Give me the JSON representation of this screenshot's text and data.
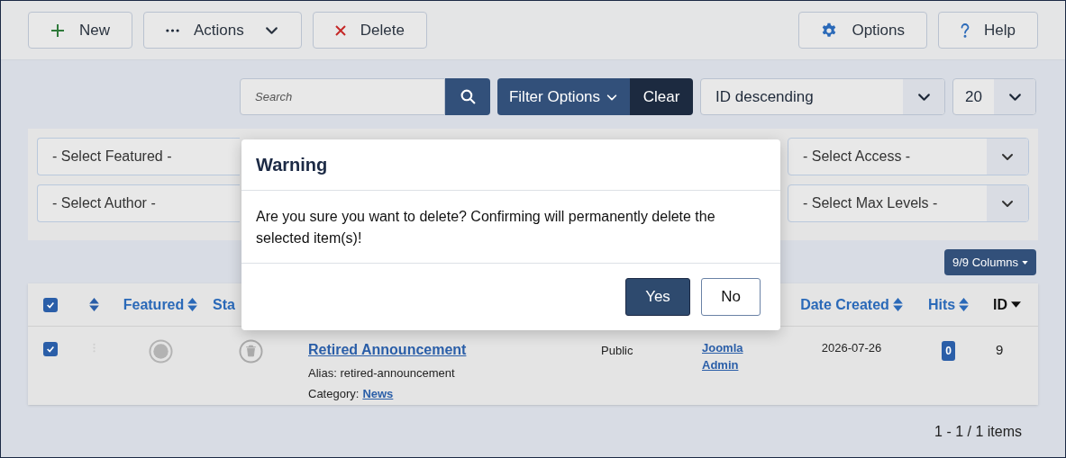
{
  "toolbar": {
    "left": [
      {
        "kind": "new",
        "label": "New",
        "dropdown": false
      },
      {
        "kind": "actions",
        "label": "Actions",
        "dropdown": true
      },
      {
        "kind": "delete",
        "label": "Delete",
        "dropdown": false
      }
    ],
    "right": [
      {
        "kind": "options",
        "label": "Options",
        "dropdown": false
      },
      {
        "kind": "help",
        "label": "Help",
        "dropdown": false
      }
    ]
  },
  "search": {
    "placeholder": "Search"
  },
  "filter_button": "Filter Options",
  "clear_button": "Clear",
  "sort_select": "ID descending",
  "limit_select": "20",
  "filters": {
    "left": [
      "- Select Featured -",
      "- Select Author -"
    ],
    "right": [
      "- Select Access -",
      "- Select Max Levels -"
    ]
  },
  "columns_button": "9/9 Columns",
  "table": {
    "columns": [
      {
        "kind": "checkbox",
        "checked": true
      },
      {
        "kind": "ordering"
      },
      {
        "kind": "sortable",
        "label": "Featured"
      },
      {
        "kind": "plain",
        "label": "Sta"
      },
      {
        "kind": "sortable",
        "label": "Date Created"
      },
      {
        "kind": "sortable",
        "label": "Hits"
      },
      {
        "kind": "sorted_desc",
        "label": "ID"
      }
    ],
    "rows": [
      {
        "selected": true,
        "featured": false,
        "trashed": true,
        "title": "Retired Announcement",
        "alias": "Alias: retired-announcement",
        "category_label": "Category:",
        "category": "News",
        "access": "Public",
        "author": "Joomla Admin",
        "date": "2026-07-26",
        "hits": "0",
        "id": "9"
      }
    ]
  },
  "pagination": "1 - 1 / 1 items",
  "modal": {
    "title": "Warning",
    "message": "Are you sure you want to delete? Confirming will permanently delete the selected item(s)!",
    "buttons": [
      {
        "label": "Yes",
        "primary": true
      },
      {
        "label": "No",
        "primary": false
      }
    ]
  }
}
